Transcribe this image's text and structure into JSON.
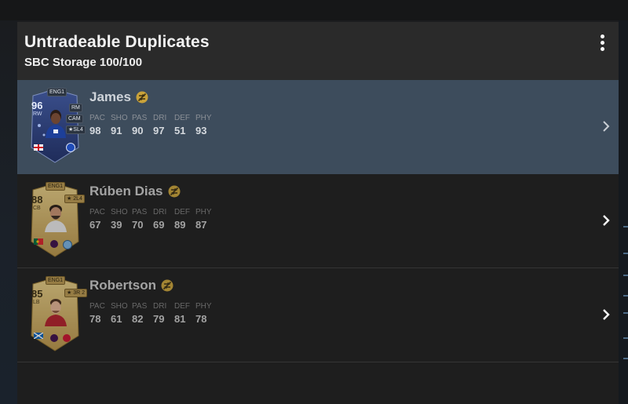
{
  "header": {
    "title": "Untradeable Duplicates",
    "subtitle": "SBC Storage 100/100"
  },
  "players": [
    {
      "name": "James",
      "rating": "96",
      "position": "RW",
      "league_tag": "ENG1",
      "alt_positions": [
        "RM",
        "CAM"
      ],
      "skill_tag": "★SL4",
      "card_style": "blue",
      "selected": true,
      "stats": [
        {
          "label": "PAC",
          "value": "98"
        },
        {
          "label": "SHO",
          "value": "91"
        },
        {
          "label": "PAS",
          "value": "90"
        },
        {
          "label": "DRI",
          "value": "97"
        },
        {
          "label": "DEF",
          "value": "51"
        },
        {
          "label": "PHY",
          "value": "93"
        }
      ]
    },
    {
      "name": "Rúben Dias",
      "rating": "88",
      "position": "CB",
      "league_tag": "ENG1",
      "alt_positions": [],
      "skill_tag": "★ 2L4",
      "card_style": "gold",
      "selected": false,
      "stats": [
        {
          "label": "PAC",
          "value": "67"
        },
        {
          "label": "SHO",
          "value": "39"
        },
        {
          "label": "PAS",
          "value": "70"
        },
        {
          "label": "DRI",
          "value": "69"
        },
        {
          "label": "DEF",
          "value": "89"
        },
        {
          "label": "PHY",
          "value": "87"
        }
      ]
    },
    {
      "name": "Robertson",
      "rating": "85",
      "position": "LB",
      "league_tag": "ENG1",
      "alt_positions": [],
      "skill_tag": "★ 3R 2",
      "card_style": "gold",
      "selected": false,
      "stats": [
        {
          "label": "PAC",
          "value": "78"
        },
        {
          "label": "SHO",
          "value": "61"
        },
        {
          "label": "PAS",
          "value": "82"
        },
        {
          "label": "DRI",
          "value": "79"
        },
        {
          "label": "DEF",
          "value": "81"
        },
        {
          "label": "PHY",
          "value": "78"
        }
      ]
    }
  ],
  "icons": {
    "menu": "more-vertical-icon",
    "untradeable": "untradeable-icon",
    "row_action": "chevron-right-icon"
  },
  "colors": {
    "panel": "#1e1e1e",
    "header": "#2a2a2a",
    "selected_row": "#3d4c5c",
    "gold_card": "#d9b868",
    "blue_card": "#2c3f78",
    "untradeable_badge": "#c9a23a"
  }
}
